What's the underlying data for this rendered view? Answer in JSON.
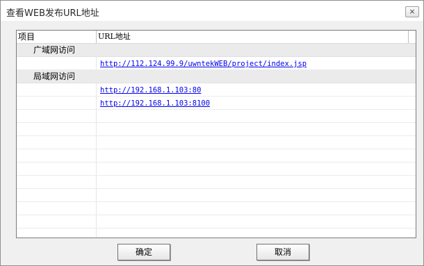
{
  "window": {
    "title": "查看WEB发布URL地址",
    "close_glyph": "⨯"
  },
  "table": {
    "columns": [
      "项目",
      "URL地址"
    ],
    "rows": [
      {
        "item": "广域网访问",
        "url": "",
        "group": true
      },
      {
        "item": "",
        "url": "http://112.124.99.9/uwntekWEB/project/index.jsp",
        "group": false
      },
      {
        "item": "局域网访问",
        "url": "",
        "group": true
      },
      {
        "item": "",
        "url": "http://192.168.1.103:80",
        "group": false
      },
      {
        "item": "",
        "url": "http://192.168.1.103:8100",
        "group": false
      }
    ]
  },
  "buttons": {
    "ok": "确定",
    "cancel": "取消"
  }
}
